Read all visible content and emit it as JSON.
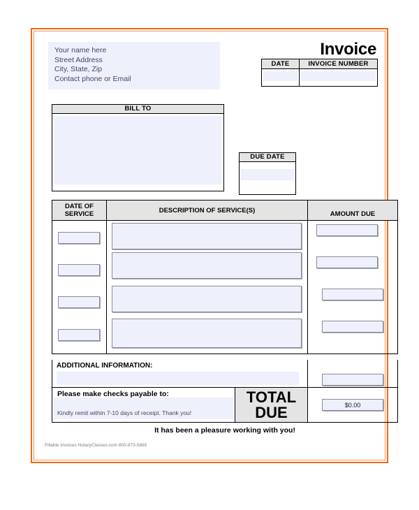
{
  "document": {
    "title": "Invoice"
  },
  "sender": {
    "lines": [
      "Your name here",
      "Street Address",
      "City, State, Zip",
      "Contact phone or Email"
    ]
  },
  "meta_table": {
    "headers": [
      "DATE",
      "INVOICE NUMBER"
    ],
    "values": [
      "",
      ""
    ]
  },
  "bill_to": {
    "header": "BILL TO",
    "value": ""
  },
  "due_date": {
    "header": "DUE DATE",
    "value": ""
  },
  "service_table": {
    "headers": {
      "date_line1": "DATE OF",
      "date_line2": "SERVICE",
      "description": "DESCRIPTION OF SERVICE(S)",
      "amount": "AMOUNT DUE"
    },
    "rows": [
      {
        "date": "",
        "description": "",
        "amount": ""
      },
      {
        "date": "",
        "description": "",
        "amount": ""
      },
      {
        "date": "",
        "description": "",
        "amount": ""
      },
      {
        "date": "",
        "description": "",
        "amount": ""
      }
    ]
  },
  "additional_information": {
    "label": "ADDITIONAL INFORMATION:",
    "value": "",
    "amount": ""
  },
  "payment": {
    "payable_label": "Please make checks payable to:",
    "payable_value": "",
    "remit_note": "Kindly remit within 7-10 days of receipt. Thank you!",
    "total_label_line1": "TOTAL",
    "total_label_line2": "DUE",
    "total_amount": "$0.00"
  },
  "closing": {
    "message": "It has been a pleasure working with you!",
    "credit": "Fillable invoices NotaryClasses.com 800-873-5865"
  },
  "colors": {
    "frame": "#f26a15",
    "frame_inner": "#f79355",
    "field_fill": "#eef0fb",
    "header_fill": "#e4e4e4",
    "sender_text": "#3f4a63"
  }
}
